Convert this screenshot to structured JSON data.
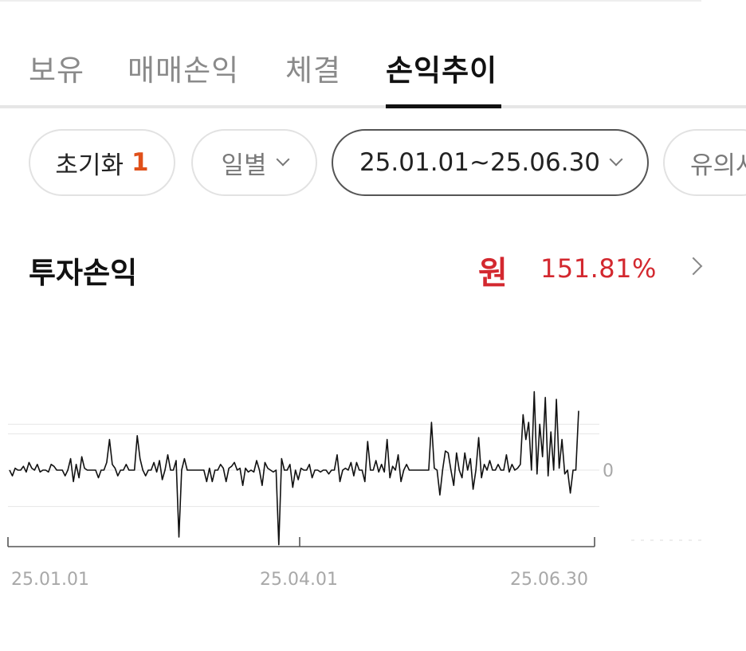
{
  "tabs": [
    {
      "label": "보유",
      "active": false
    },
    {
      "label": "매매손익",
      "active": false
    },
    {
      "label": "체결",
      "active": false
    },
    {
      "label": "손익추이",
      "active": true
    }
  ],
  "filters": {
    "reset_label": "초기화",
    "reset_count": "1",
    "period_label": "일별",
    "date_range": "25.01.01~25.06.30",
    "notice_label": "유의사"
  },
  "summary": {
    "title": "투자손익",
    "unit": "원",
    "rate": "151.81%"
  },
  "colors": {
    "accent_red": "#d3282f",
    "badge_orange": "#e0501a"
  },
  "icons": [
    "chevron-down-icon",
    "chevron-right-icon"
  ],
  "chart_data": {
    "type": "line",
    "title": "",
    "xlabel": "",
    "ylabel": "",
    "x_ticks": [
      "25.01.01",
      "25.04.01",
      "25.06.30"
    ],
    "y_ticks": [
      "0"
    ],
    "ylim": [
      -4,
      6
    ],
    "grid": true,
    "series": [
      {
        "values": [
          0,
          -0.3,
          0.1,
          0,
          0,
          0.2,
          -0.1,
          0.4,
          0.1,
          0,
          0.3,
          -0.1,
          0,
          0,
          -0.1,
          0.3,
          0.2,
          0,
          0,
          0,
          -0.3,
          0,
          0.6,
          -0.6,
          0.3,
          -0.4,
          0.7,
          0.1,
          0,
          0,
          0,
          0,
          -0.4,
          0,
          0,
          0.4,
          1.6,
          0.3,
          0.1,
          -0.3,
          0,
          0,
          0.3,
          0,
          0,
          0,
          1.8,
          0.6,
          0,
          -0.3,
          0,
          0,
          0.4,
          -0.1,
          0.5,
          -0.5,
          0,
          0.8,
          0,
          0,
          0.5,
          -3.5,
          0,
          0.6,
          0,
          0,
          0,
          0,
          0,
          0,
          0,
          -0.6,
          0.1,
          -0.6,
          0,
          0,
          0.3,
          0.1,
          -0.6,
          0.1,
          0.2,
          0.4,
          0,
          0.1,
          -0.8,
          0.1,
          -0.1,
          0,
          -0.1,
          0.5,
          0,
          -0.8,
          0.4,
          0.1,
          0,
          -0.1,
          0,
          -3.9,
          0.6,
          0,
          0,
          0.3,
          -0.9,
          0,
          -0.5,
          0.1,
          0,
          0,
          0.3,
          -0.4,
          0,
          0,
          -0.1,
          0,
          0,
          -0.2,
          0,
          0,
          0.8,
          -0.6,
          0,
          0.1,
          0,
          0.4,
          -0.3,
          0.4,
          0,
          0,
          -0.6,
          1.5,
          0,
          0,
          0.5,
          -0.1,
          0.3,
          -0.1,
          1.6,
          -0.4,
          0.2,
          0,
          0.8,
          -0.6,
          0,
          0.3,
          0,
          0,
          0,
          0,
          0,
          0,
          0,
          0,
          2.5,
          0.1,
          0,
          -1.3,
          0,
          1,
          0.9,
          0,
          -0.8,
          0.9,
          0,
          -0.4,
          0.9,
          0,
          0.6,
          -1,
          0,
          1.7,
          -0.4,
          0.3,
          0,
          0.5,
          0,
          0,
          0.3,
          0,
          0,
          0.8,
          -0.1,
          0.3,
          0,
          0.1,
          0.3,
          2.9,
          1.6,
          2.5,
          0,
          4.1,
          -0.2,
          2.4,
          0.7,
          3.8,
          -0.3,
          2,
          0,
          3.7,
          0.1,
          1.6,
          -0.2,
          0,
          -1.2,
          0,
          0,
          3.1
        ]
      }
    ]
  }
}
